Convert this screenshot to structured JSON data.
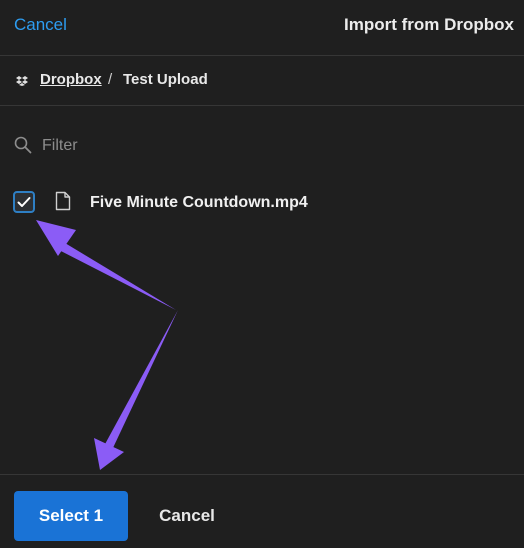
{
  "header": {
    "cancel_label": "Cancel",
    "title": "Import from Dropbox"
  },
  "breadcrumb": {
    "root": "Dropbox",
    "separator": "/",
    "current": "Test Upload"
  },
  "filter": {
    "placeholder": "Filter",
    "value": ""
  },
  "files": [
    {
      "name": "Five Minute Countdown.mp4",
      "checked": true,
      "icon": "file-icon"
    }
  ],
  "footer": {
    "select_label": "Select 1",
    "cancel_label": "Cancel"
  },
  "colors": {
    "background": "#1f1f1f",
    "accent": "#1a73d6",
    "link": "#2d9cf0",
    "annotation_arrow": "#8b5cf6"
  }
}
